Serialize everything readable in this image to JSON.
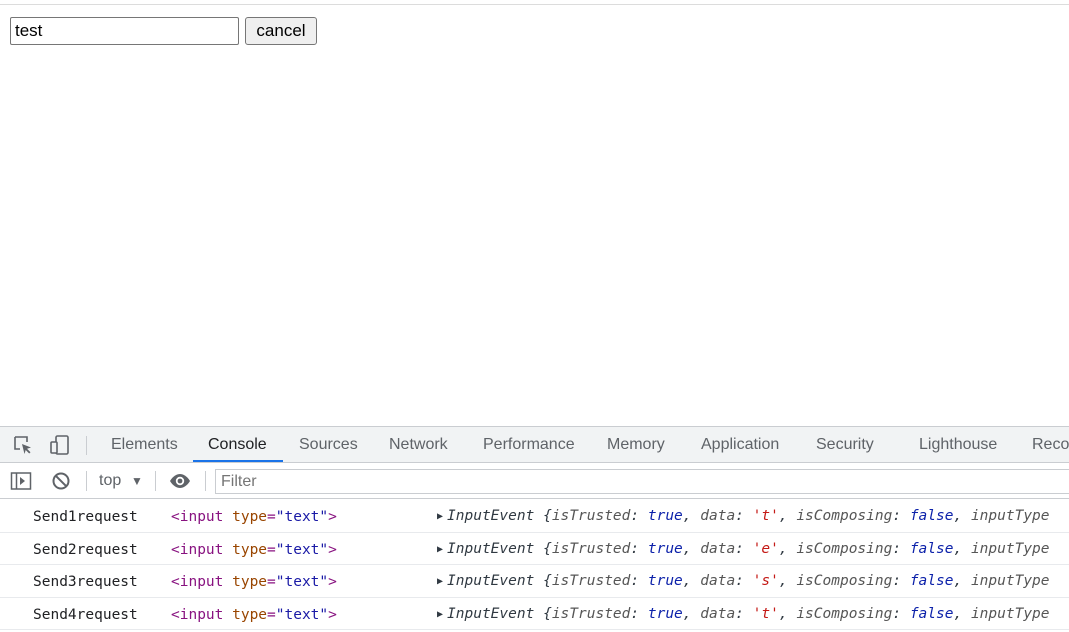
{
  "page": {
    "input_value": "test",
    "cancel_label": "cancel"
  },
  "devtools": {
    "tabs": [
      {
        "label": "Elements"
      },
      {
        "label": "Console",
        "active": true
      },
      {
        "label": "Sources"
      },
      {
        "label": "Network"
      },
      {
        "label": "Performance"
      },
      {
        "label": "Memory"
      },
      {
        "label": "Application"
      },
      {
        "label": "Security"
      },
      {
        "label": "Lighthouse"
      },
      {
        "label": "Reco"
      }
    ],
    "toolbar": {
      "context": "top",
      "filter_placeholder": "Filter"
    },
    "console_rows": [
      {
        "message": "Send1request",
        "elem_open": "<input ",
        "elem_attr": "type",
        "elem_eq": "=",
        "elem_val": "\"text\"",
        "elem_close": ">",
        "obj_name": "InputEvent",
        "obj_brace": "{",
        "k1": "isTrusted",
        "v1": "true",
        "k2": "data",
        "v2": "'t'",
        "k3": "isComposing",
        "v3": "false",
        "k4": "inputType"
      },
      {
        "message": "Send2request",
        "elem_open": "<input ",
        "elem_attr": "type",
        "elem_eq": "=",
        "elem_val": "\"text\"",
        "elem_close": ">",
        "obj_name": "InputEvent",
        "obj_brace": "{",
        "k1": "isTrusted",
        "v1": "true",
        "k2": "data",
        "v2": "'e'",
        "k3": "isComposing",
        "v3": "false",
        "k4": "inputType"
      },
      {
        "message": "Send3request",
        "elem_open": "<input ",
        "elem_attr": "type",
        "elem_eq": "=",
        "elem_val": "\"text\"",
        "elem_close": ">",
        "obj_name": "InputEvent",
        "obj_brace": "{",
        "k1": "isTrusted",
        "v1": "true",
        "k2": "data",
        "v2": "'s'",
        "k3": "isComposing",
        "v3": "false",
        "k4": "inputType"
      },
      {
        "message": "Send4request",
        "elem_open": "<input ",
        "elem_attr": "type",
        "elem_eq": "=",
        "elem_val": "\"text\"",
        "elem_close": ">",
        "obj_name": "InputEvent",
        "obj_brace": "{",
        "k1": "isTrusted",
        "v1": "true",
        "k2": "data",
        "v2": "'t'",
        "k3": "isComposing",
        "v3": "false",
        "k4": "inputType"
      }
    ]
  },
  "colors": {
    "active_tab_accent": "#1a73e8",
    "tag": "#881280",
    "attribute": "#994500",
    "attribute_value": "#1a1aa6",
    "keyword_value": "#0d22aa",
    "string_value": "#c41a16"
  },
  "icons": [
    "inspect-element-icon",
    "device-toolbar-icon",
    "sidebar-toggle-icon",
    "clear-console-icon",
    "dropdown-arrow-icon",
    "live-expression-eye-icon",
    "expand-triangle-icon"
  ]
}
